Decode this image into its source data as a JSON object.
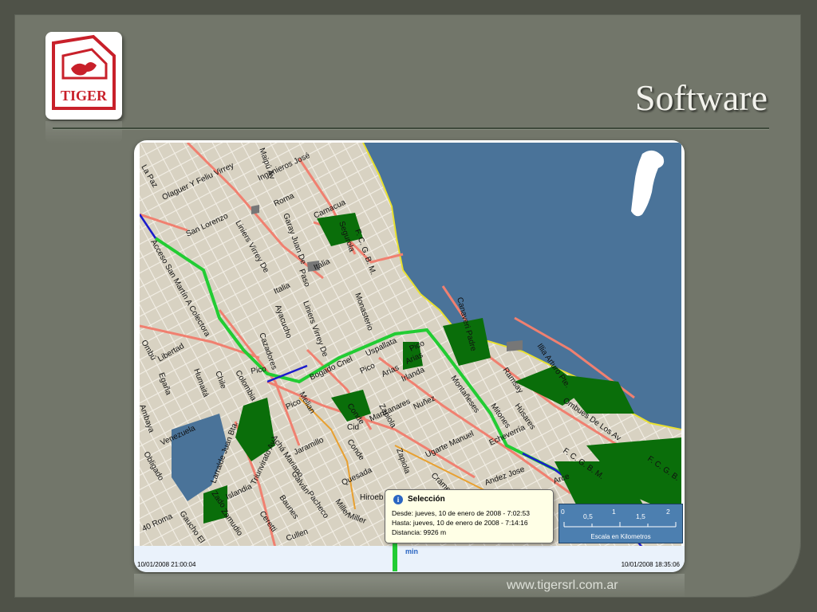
{
  "slide": {
    "title": "Software",
    "footer_url": "www.tigersrl.com.ar",
    "logo_text": "TIGER"
  },
  "colors": {
    "slide_bg": "#72766a",
    "water": "#4a7399",
    "route_green": "#22cc33",
    "route_blue": "#1a1acc",
    "park": "#0a6e0a"
  },
  "map": {
    "street_labels": [
      "La Paz",
      "Olaguer Y Feliu Virrey",
      "Maipú Av",
      "Ingenieros José",
      "Roma",
      "Camacua",
      "Garay Juan De",
      "Segurola",
      "F. C. G. B. M.",
      "San Lorenzo",
      "Liniers Virrey De",
      "Acceso San Martín A Colectora",
      "Italia",
      "Paso",
      "Italia",
      "Monasterio",
      "Ayacucho",
      "Liniers Virrey De",
      "Cazadores",
      "Uspallata",
      "Pico",
      "Bogado Cnel",
      "Arias",
      "Arias",
      "Pico",
      "Irlanda",
      "Ombú",
      "Libertad",
      "Egaña",
      "Humaitá",
      "Chile",
      "Colombia",
      "Montañeses",
      "Melian",
      "Pico",
      "Zapiola",
      "Manzanares",
      "Conde",
      "Nuñez",
      "Canaveri Padre",
      "Illia Arturo Pte.",
      "Ramsay",
      "Húsares",
      "Mitones",
      "Ombues De Los Av",
      "Echeverría",
      "Venezuela",
      "Pico",
      "Larralde Juan Bta.",
      "Achá Mariano",
      "Jaramillo",
      "Conde",
      "Zapiola",
      "Ugarte Manuel",
      "Quesada",
      "Triunvirato Av",
      "Islandia",
      "Galván",
      "Pacheco",
      "Miller",
      "Miller",
      "Baunes",
      "Ceretti",
      "Cullen",
      "Hiroeb",
      "Crámer",
      "Andez Jose",
      "Arce",
      "F. C. G. B. M.",
      "F. C. G. B.",
      "Zado",
      "Zamudio",
      "Gaucho El",
      "40 Roma",
      "Obligado",
      "Ambaya",
      "Cid"
    ]
  },
  "popup": {
    "icon": "info-icon",
    "title": "Selección",
    "from": "Desde: jueves, 10 de enero de 2008 - 7:02:53",
    "to": "Hasta: jueves, 10 de enero de 2008 - 7:14:16",
    "distance": "Distancia: 9926 m"
  },
  "scale_bar": {
    "ticks": [
      "0",
      "0,5",
      "1",
      "1,5",
      "2"
    ],
    "caption": "Escala en Kilometros"
  },
  "timeline": {
    "start": "10/01/2008 21:00:04",
    "end": "10/01/2008 18:35:06",
    "unit": "min",
    "selection_fraction": 0.47
  }
}
